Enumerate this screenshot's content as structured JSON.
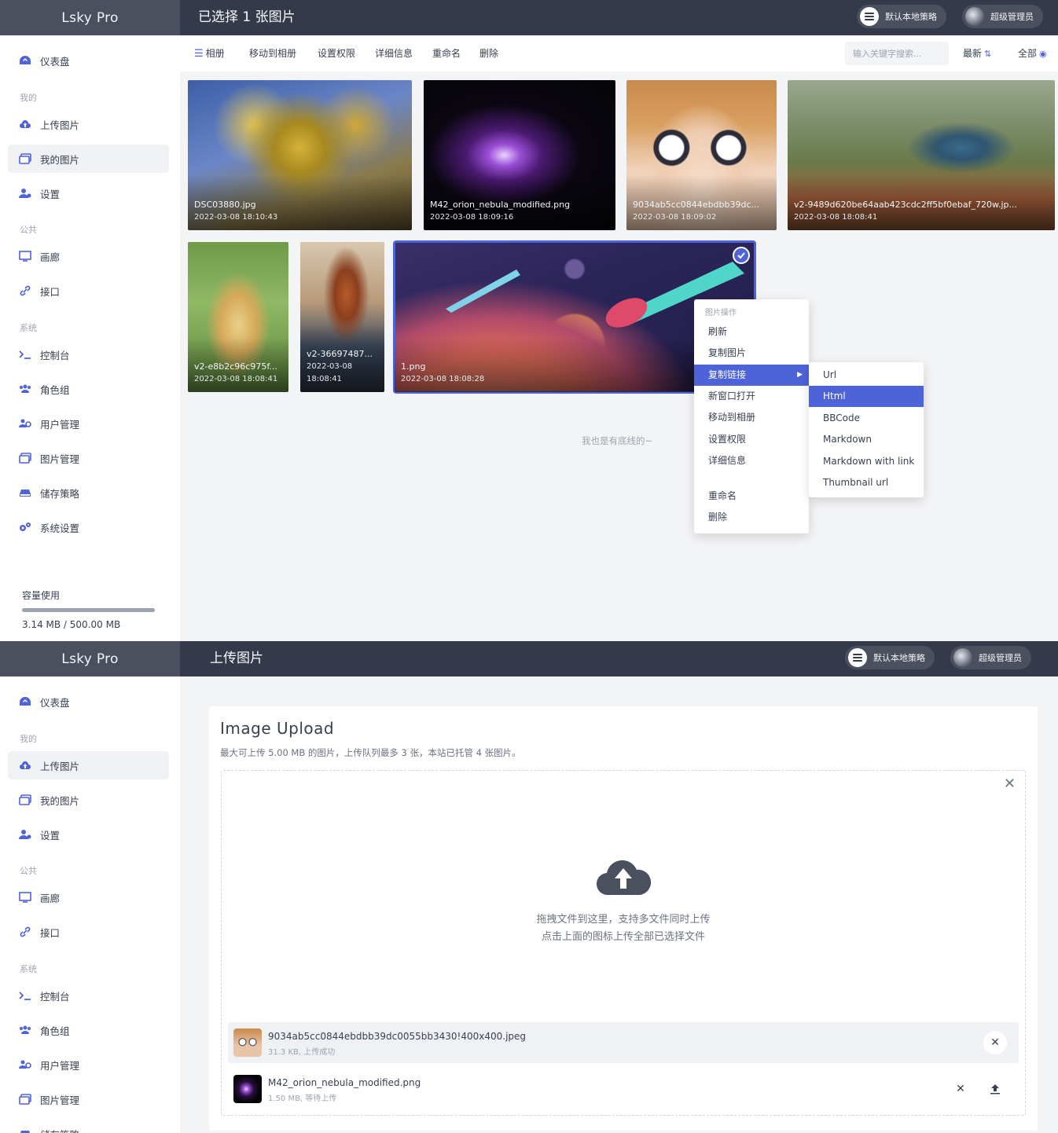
{
  "brand": "Lsky Pro",
  "header": {
    "strategy_label": "默认本地策略",
    "user_label": "超级管理员"
  },
  "screen1": {
    "page_title": "已选择 1 张图片",
    "toolbar": {
      "album": "相册",
      "move": "移动到相册",
      "permission": "设置权限",
      "details": "详细信息",
      "rename": "重命名",
      "delete": "删除",
      "search_placeholder": "输入关键字搜索...",
      "sort": "最新",
      "filter": "全部"
    },
    "images": [
      {
        "name": "DSC03880.jpg",
        "date": "2022-03-08 18:10:43"
      },
      {
        "name": "M42_orion_nebula_modified.png",
        "date": "2022-03-08 18:09:16"
      },
      {
        "name": "9034ab5cc0844ebdbb39dc...",
        "date": "2022-03-08 18:09:02"
      },
      {
        "name": "v2-9489d620be64aab423cdc2ff5bf0ebaf_720w.jp...",
        "date": "2022-03-08 18:08:41"
      },
      {
        "name": "v2-e8b2c96c975f...",
        "date": "2022-03-08 18:08:41"
      },
      {
        "name": "v2-36697487...",
        "date": "2022-03-08",
        "date2": "18:08:41"
      },
      {
        "name": "1.png",
        "date": "2022-03-08 18:08:28"
      }
    ],
    "footer_note": "我也是有底线的~",
    "context_menu": {
      "header": "图片操作",
      "items": [
        "刷新",
        "复制图片",
        "复制链接",
        "新窗口打开",
        "移动到相册",
        "设置权限",
        "详细信息",
        "重命名",
        "删除"
      ]
    },
    "submenu": [
      "Url",
      "Html",
      "BBCode",
      "Markdown",
      "Markdown with link",
      "Thumbnail url"
    ]
  },
  "sidebar": {
    "dashboard": "仪表盘",
    "section_mine": "我的",
    "upload": "上传图片",
    "my_images": "我的图片",
    "settings": "设置",
    "section_public": "公共",
    "gallery": "画廊",
    "api": "接口",
    "section_system": "系统",
    "console": "控制台",
    "roles": "角色组",
    "users": "用户管理",
    "image_manage": "图片管理",
    "storage": "储存策略",
    "system_settings": "系统设置",
    "quota_label": "容量使用",
    "quota_value": "3.14 MB / 500.00 MB",
    "quota_fraction": 0.0063
  },
  "screen2": {
    "page_title": "上传图片",
    "card_title": "Image Upload",
    "card_sub": "最大可上传 5.00 MB 的图片，上传队列最多 3 张，本站已托管 4 张图片。",
    "dz_line1": "拖拽文件到这里，支持多文件同时上传",
    "dz_line2": "点击上面的图标上传全部已选择文件",
    "files": [
      {
        "name": "9034ab5cc0844ebdbb39dc0055bb3430!400x400.jpeg",
        "meta": "31.3 KB, 上传成功"
      },
      {
        "name": "M42_orion_nebula_modified.png",
        "meta": "1.50 MB, 等待上传"
      }
    ]
  },
  "colors": {
    "accent": "#4f63d9",
    "topbar": "#353a4a",
    "brand_bg": "#4b505e"
  }
}
